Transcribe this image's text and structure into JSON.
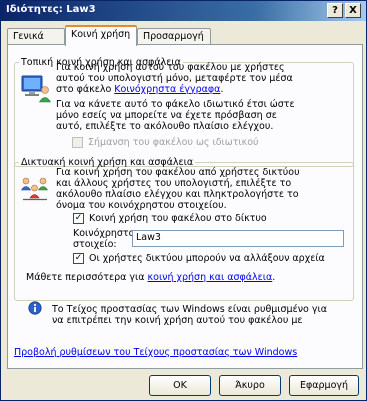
{
  "window": {
    "title": "Ιδιότητες: Law3",
    "help_glyph": "?",
    "close_glyph": "X"
  },
  "tabs": [
    {
      "label": "Γενικά"
    },
    {
      "label": "Κοινή χρήση"
    },
    {
      "label": "Προσαρμογή"
    }
  ],
  "local": {
    "legend": "Τοπική κοινή χρήση και ασφάλεια",
    "text1_lines": [
      "Για κοινή χρήση αυτού του φακέλου με χρήστες",
      "αυτού του υπολογιστή μόνο, μεταφέρτε τον μέσα"
    ],
    "text1_prefix": "στο φάκελο ",
    "text1_link": "Κοινόχρηστα έγγραφα",
    "text1_suffix": ".",
    "text2_lines": [
      "Για να κάνετε αυτό το φάκελο ιδιωτικό έτσι ώστε",
      "μόνο εσείς να μπορείτε να έχετε πρόσβαση σε",
      "αυτό, επιλέξτε το ακόλουθο πλαίσιο ελέγχου."
    ],
    "private_checkbox_label": "Σήμανση του φακέλου ως ιδιωτικού"
  },
  "network": {
    "legend": "Δικτυακή κοινή χρήση και ασφάλεια",
    "text_lines": [
      "Για κοινή χρήση του φακέλου από χρήστες δικτύου",
      "και άλλους χρήστες του υπολογιστή, επιλέξτε το",
      "ακόλουθο πλαίσιο ελέγχου και πληκτρολογήστε το",
      "όνομα του κοινόχρηστου στοιχείου."
    ],
    "share_checkbox_label": "Κοινή χρήση του φακέλου στο δίκτυο",
    "share_name_label_line1": "Κοινόχρηστο",
    "share_name_label_line2": "στοιχείο:",
    "share_name_value": "Law3",
    "allow_change_checkbox_label": "Οι χρήστες δικτύου μπορούν να αλλάξουν αρχεία",
    "learn_more_prefix": "Μάθετε περισσότερα για ",
    "learn_more_link": "κοινή χρήση και ασφάλεια",
    "learn_more_suffix": "."
  },
  "firewall": {
    "info_lines": [
      "Το Τείχος προστασίας των Windows είναι ρυθμισμένο για",
      "να επιτρέπει την κοινή χρήση αυτού του φακέλου με"
    ],
    "settings_link": "Προβολή ρυθμίσεων του Τείχους προστασίας των Windows"
  },
  "buttons": {
    "ok": "OK",
    "cancel": "Άκυρο",
    "apply": "Εφαρμογή"
  },
  "state": {
    "private_checked": false,
    "share_checked": true,
    "allow_change_checked": true
  }
}
